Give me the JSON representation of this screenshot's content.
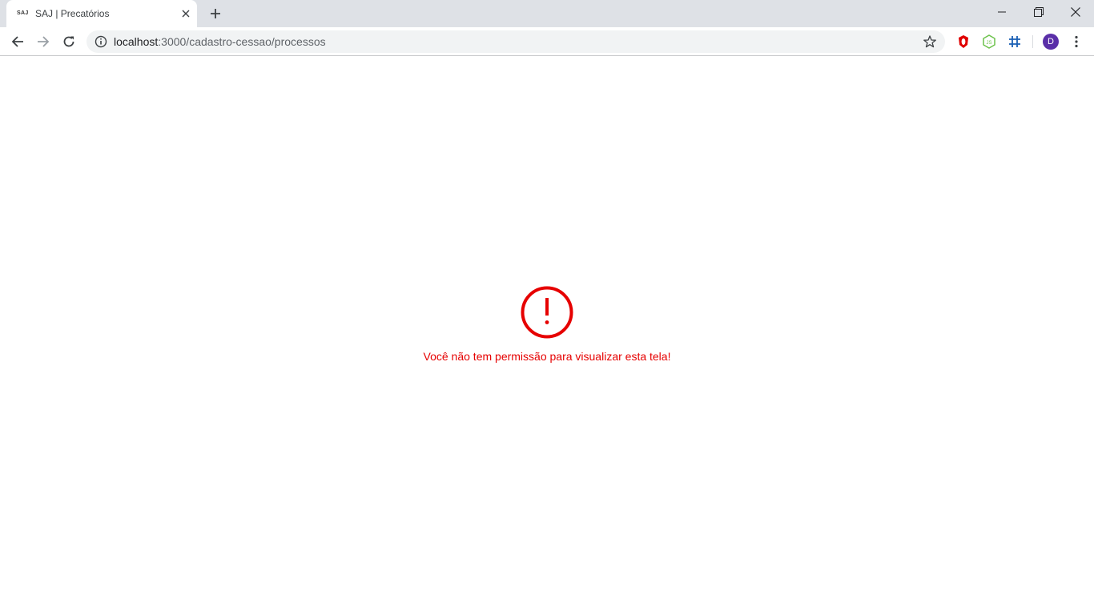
{
  "browser": {
    "tab": {
      "favicon_text": "SAJ",
      "title": "SAJ | Precatórios"
    },
    "address_bar": {
      "host": "localhost",
      "path": ":3000/cadastro-cessao/processos"
    },
    "profile_initial": "D"
  },
  "page": {
    "error_message": "Você não tem permissão para visualizar esta tela!",
    "error_color": "#e60000"
  }
}
